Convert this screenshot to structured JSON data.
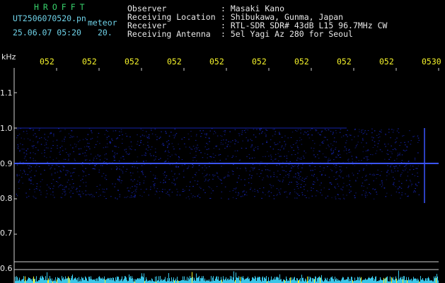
{
  "header": {
    "app_name": "HROFFT",
    "filename": "UT2506070520.pn",
    "mode_label": "meteor",
    "datetime": "25.06.07 05:20",
    "count": "20.",
    "fields": [
      {
        "label": "Observer",
        "value": "Masaki Kano"
      },
      {
        "label": "Receiving Location",
        "value": "Shibukawa, Gunma, Japan"
      },
      {
        "label": "Receiver",
        "value": "RTL-SDR SDR# 43dB L15 96.7MHz CW"
      },
      {
        "label": "Receiving Antenna",
        "value": "5el Yagi Az 280 for Seoul"
      }
    ]
  },
  "chart_data": {
    "type": "heatmap",
    "ylabel": "kHz",
    "y_ticks": [
      "1.1",
      "1.0",
      "0.9",
      "0.8",
      "0.7",
      "0.6"
    ],
    "x_ticks": [
      "052",
      "052",
      "052",
      "052",
      "052",
      "052",
      "052",
      "052",
      "052",
      "0530"
    ],
    "ylim": [
      0.6,
      1.1
    ],
    "signal_line_khz": 0.9,
    "noise_band_khz": [
      0.8,
      1.0
    ],
    "colors": {
      "signal": "#3b55ff",
      "noise": "#1a2bd0",
      "spectrum": "#39c6e8",
      "grid": "#d0d0d0"
    }
  }
}
